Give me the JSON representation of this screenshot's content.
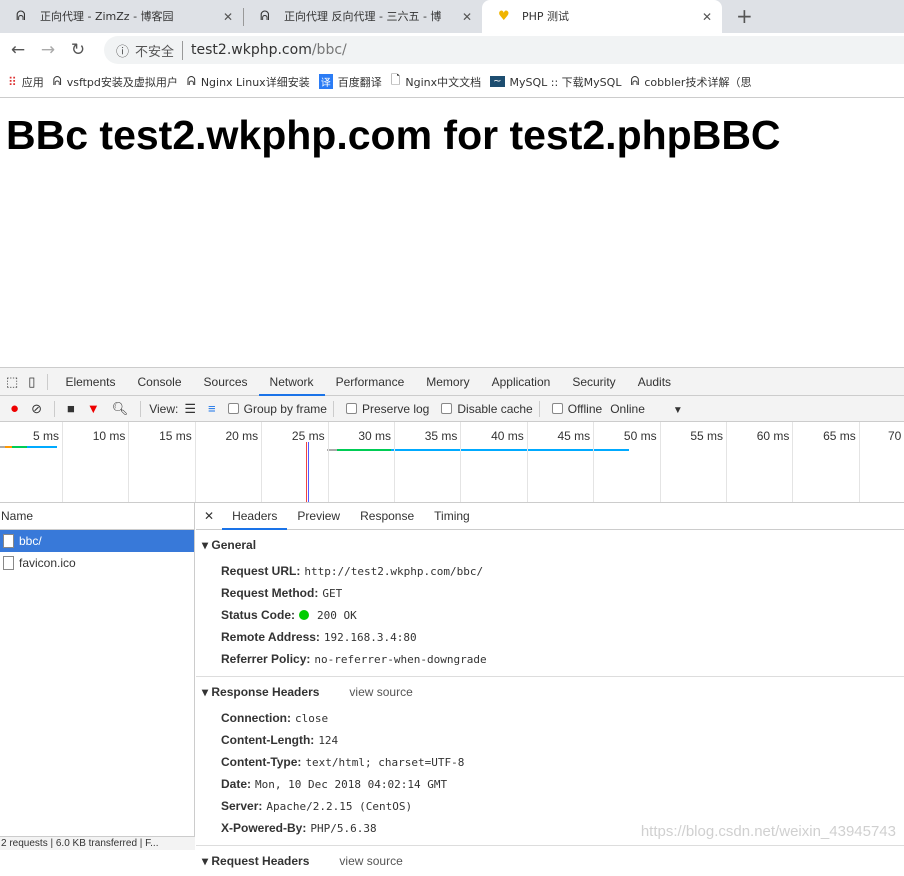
{
  "browser": {
    "tabs": [
      {
        "title": "正向代理 - ZimZz - 博客园",
        "icon": "blog-icon"
      },
      {
        "title": "正向代理 反向代理 - 三六五 - 博",
        "icon": "blog-icon"
      },
      {
        "title": "PHP 测试",
        "icon": "php-icon",
        "active": true
      }
    ],
    "address": {
      "security": "不安全",
      "host": "test2.wkphp.com",
      "path": "/bbc/"
    },
    "bookmarks": [
      {
        "label": "应用",
        "icon": "apps-icon"
      },
      {
        "label": "vsftpd安装及虚拟用户",
        "icon": "blog-icon"
      },
      {
        "label": "Nginx Linux详细安装",
        "icon": "blog-icon"
      },
      {
        "label": "百度翻译",
        "icon": "translate-icon"
      },
      {
        "label": "Nginx中文文档",
        "icon": "page-icon"
      },
      {
        "label": "MySQL :: 下载MySQL",
        "icon": "mysql-icon"
      },
      {
        "label": "cobbler技术详解（思",
        "icon": "blog-icon"
      }
    ]
  },
  "page": {
    "heading": "BBc test2.wkphp.com for test2.phpBBC"
  },
  "devtools": {
    "tabs": [
      "Elements",
      "Console",
      "Sources",
      "Network",
      "Performance",
      "Memory",
      "Application",
      "Security",
      "Audits"
    ],
    "active_tab": "Network",
    "toolbar": {
      "view": "View:",
      "group_by_frame": "Group by frame",
      "preserve_log": "Preserve log",
      "disable_cache": "Disable cache",
      "offline": "Offline",
      "throttle": "Online"
    },
    "timeline_ticks": [
      "5 ms",
      "10 ms",
      "15 ms",
      "20 ms",
      "25 ms",
      "30 ms",
      "35 ms",
      "40 ms",
      "45 ms",
      "50 ms",
      "55 ms",
      "60 ms",
      "65 ms",
      "70"
    ],
    "requests_header": "Name",
    "requests": [
      "bbc/",
      "favicon.ico"
    ],
    "footer": "2 requests | 6.0 KB transferred | F...",
    "detail_tabs": [
      "Headers",
      "Preview",
      "Response",
      "Timing"
    ],
    "general": {
      "title": "General",
      "items": [
        {
          "k": "Request URL:",
          "v": "http://test2.wkphp.com/bbc/"
        },
        {
          "k": "Request Method:",
          "v": "GET"
        },
        {
          "k": "Status Code:",
          "v": "200 OK"
        },
        {
          "k": "Remote Address:",
          "v": "192.168.3.4:80"
        },
        {
          "k": "Referrer Policy:",
          "v": "no-referrer-when-downgrade"
        }
      ]
    },
    "response_headers": {
      "title": "Response Headers",
      "view_source": "view source",
      "items": [
        {
          "k": "Connection:",
          "v": "close"
        },
        {
          "k": "Content-Length:",
          "v": "124"
        },
        {
          "k": "Content-Type:",
          "v": "text/html; charset=UTF-8"
        },
        {
          "k": "Date:",
          "v": "Mon, 10 Dec 2018 04:02:14 GMT"
        },
        {
          "k": "Server:",
          "v": "Apache/2.2.15 (CentOS)"
        },
        {
          "k": "X-Powered-By:",
          "v": "PHP/5.6.38"
        }
      ]
    },
    "request_headers": {
      "title": "Request Headers",
      "view_source": "view source"
    }
  },
  "watermark": "https://blog.csdn.net/weixin_43945743"
}
